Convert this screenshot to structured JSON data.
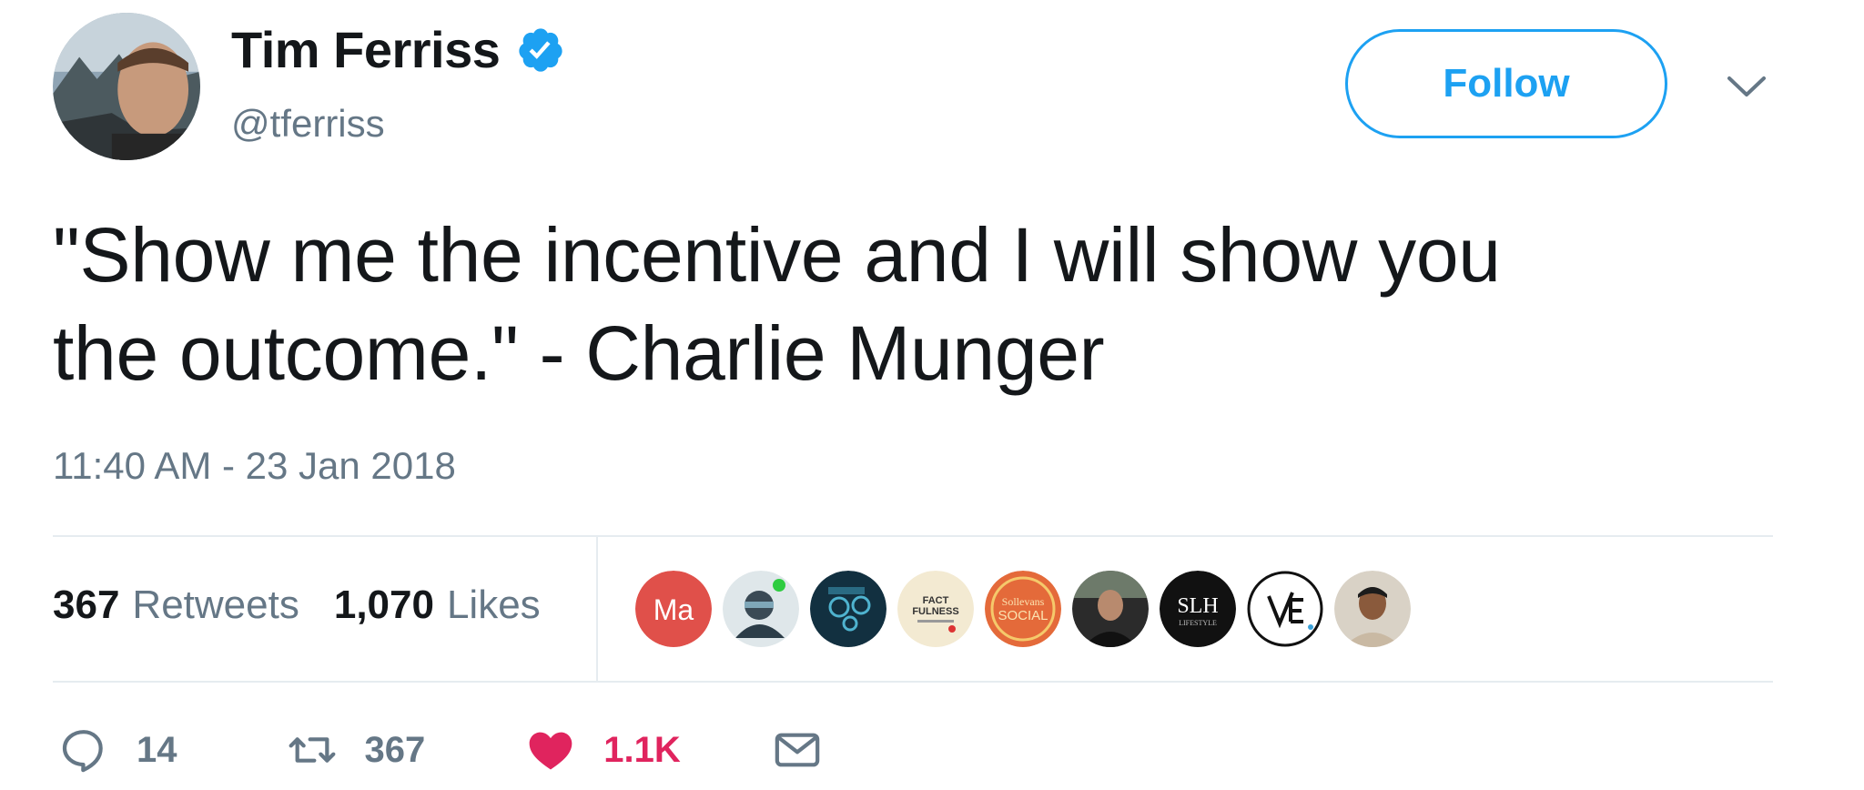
{
  "author": {
    "name": "Tim Ferriss",
    "handle": "@tferriss",
    "verified": true,
    "avatar_icon": "profile-photo"
  },
  "follow_button": {
    "label": "Follow"
  },
  "tweet": {
    "text_line1": "\"Show me the incentive and I will show you",
    "text_line2": "the outcome.\" - Charlie Munger",
    "timestamp": "11:40 AM - 23 Jan 2018"
  },
  "stats": {
    "retweets_count": "367",
    "retweets_label": "Retweets",
    "likes_count": "1,070",
    "likes_label": "Likes"
  },
  "likers": [
    {
      "label": "Ma",
      "color": "#e0504a"
    },
    {
      "label": "",
      "color": "#3a4a55"
    },
    {
      "label": "",
      "color": "#123040"
    },
    {
      "label": "FACT FULNESS",
      "color": "#f3ead2"
    },
    {
      "label": "Sollevans SOCIAL",
      "color": "#e46a3a"
    },
    {
      "label": "",
      "color": "#2b2b2b"
    },
    {
      "label": "SLH",
      "sublabel": "LIFESTYLE",
      "color": "#111111"
    },
    {
      "label": "VE",
      "color": "#ffffff"
    },
    {
      "label": "",
      "color": "#c9b9a3"
    }
  ],
  "actions": {
    "reply_count": "14",
    "retweet_count": "367",
    "like_count": "1.1K"
  },
  "colors": {
    "accent": "#1da1f2",
    "like": "#e0245e",
    "muted": "#657786",
    "text": "#14171a",
    "divider": "#e6ecf0"
  }
}
